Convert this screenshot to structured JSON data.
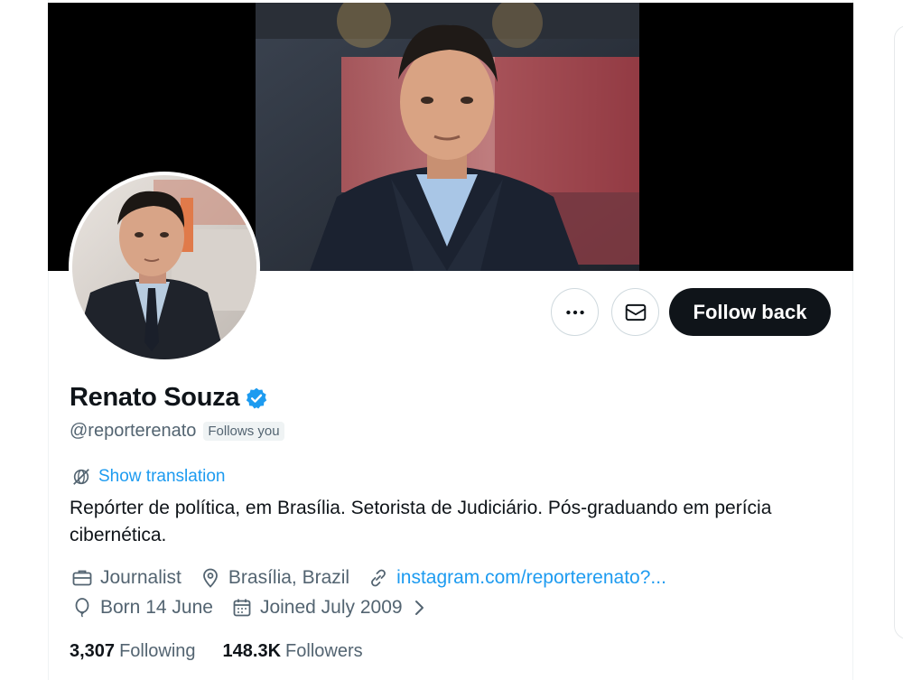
{
  "profile": {
    "name": "Renato Souza",
    "handle": "@reporterenato",
    "follows_you": "Follows you",
    "verified": true
  },
  "actions": {
    "more_icon": "more-horizontal-icon",
    "message_icon": "envelope-icon",
    "follow_back_label": "Follow back"
  },
  "translation": {
    "label": "Show translation",
    "icon": "globe-slash-icon"
  },
  "bio": "Repórter de política, em Brasília. Setorista de Judiciário. Pós-graduando em perícia cibernética.",
  "meta": {
    "profession": "Journalist",
    "location": "Brasília, Brazil",
    "website": "instagram.com/reporterenato?...",
    "birthday": "Born 14 June",
    "joined": "Joined July 2009"
  },
  "stats": {
    "following_count": "3,307",
    "following_label": "Following",
    "followers_count": "148.3K",
    "followers_label": "Followers"
  },
  "colors": {
    "accent": "#1d9bf0",
    "text": "#0f1419",
    "secondary": "#536471",
    "button_dark": "#0f1419"
  }
}
